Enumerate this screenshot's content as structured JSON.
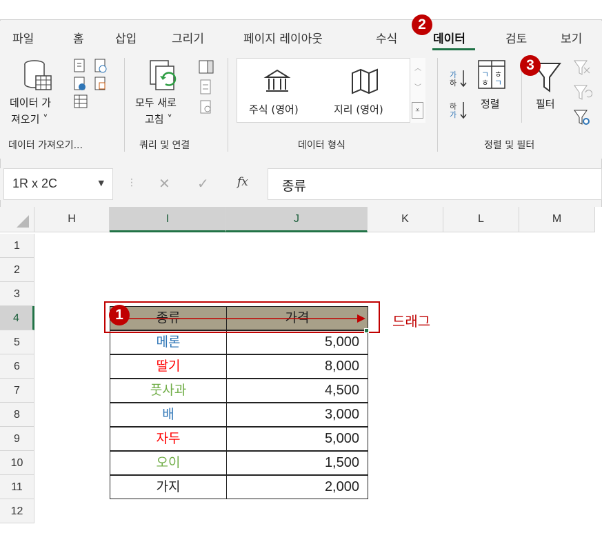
{
  "tabs": [
    "파일",
    "홈",
    "삽입",
    "그리기",
    "페이지 레이아웃",
    "수식",
    "데이터",
    "검토",
    "보기"
  ],
  "active_tab": "데이터",
  "ribbon": {
    "get_data_line1": "데이터 가",
    "get_data_line2": "져오기 ˅",
    "refresh_line1": "모두 새로",
    "refresh_line2": "고침 ˅",
    "stocks": "주식 (영어)",
    "geography": "지리 (영어)",
    "sort": "정렬",
    "filter": "필터",
    "sort_az": "가\n하",
    "groups": [
      "데이터 가져오기...",
      "쿼리 및 연결",
      "데이터 형식",
      "정렬 및 필터"
    ]
  },
  "formula_bar": {
    "name_box": "1R x 2C",
    "fx": "fx",
    "content": "종류"
  },
  "columns": [
    "H",
    "I",
    "J",
    "K",
    "L",
    "M"
  ],
  "rows": [
    "1",
    "2",
    "3",
    "4",
    "5",
    "6",
    "7",
    "8",
    "9",
    "10",
    "11",
    "12"
  ],
  "table": {
    "header": [
      "종류",
      "가격"
    ],
    "rows": [
      {
        "name": "메론",
        "price": "5,000",
        "color": "#2e75b6"
      },
      {
        "name": "딸기",
        "price": "8,000",
        "color": "#ff0000"
      },
      {
        "name": "풋사과",
        "price": "4,500",
        "color": "#70ad47"
      },
      {
        "name": "배",
        "price": "3,000",
        "color": "#2e75b6"
      },
      {
        "name": "자두",
        "price": "5,000",
        "color": "#ff0000"
      },
      {
        "name": "오이",
        "price": "1,500",
        "color": "#70ad47"
      },
      {
        "name": "가지",
        "price": "2,000",
        "color": "#222222"
      }
    ]
  },
  "annotations": {
    "step1": "1",
    "step2": "2",
    "step3": "3",
    "drag_label": "드래그",
    "accent": "#c00000"
  }
}
